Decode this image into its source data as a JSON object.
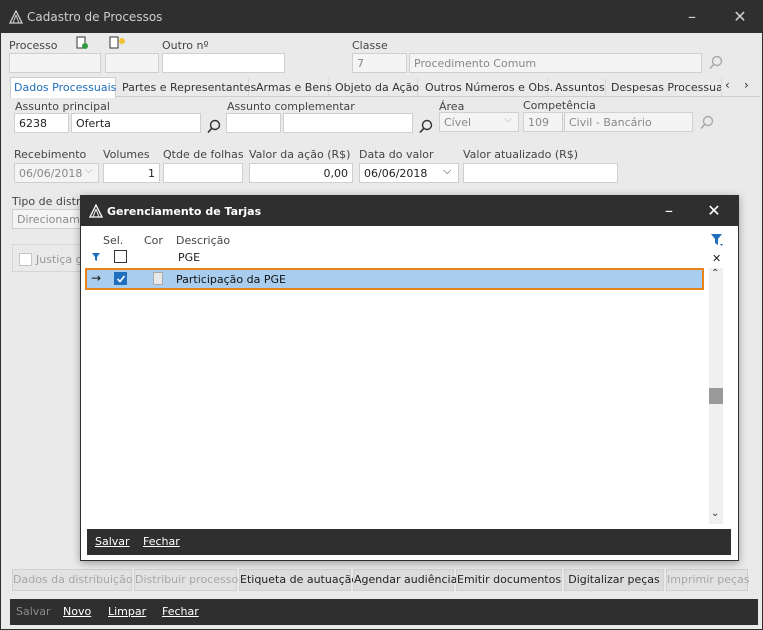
{
  "window": {
    "title": "Cadastro de Processos",
    "accent": "#1f6fbd",
    "dark": "#2f2f2f",
    "highlight_border": "#e8821a",
    "selected_row": "#a8cdee"
  },
  "header": {
    "processo_label": "Processo",
    "outro_label": "Outro nº",
    "classe_label": "Classe",
    "classe_code": "7",
    "classe_desc": "Procedimento Comum"
  },
  "tabs": [
    {
      "label": "Dados Processuais"
    },
    {
      "label": "Partes e Representantes"
    },
    {
      "label": "Armas e Bens"
    },
    {
      "label": "Objeto da Ação"
    },
    {
      "label": "Outros Números e Obs."
    },
    {
      "label": "Assuntos"
    },
    {
      "label": "Despesas Processuais"
    }
  ],
  "form": {
    "assunto_principal_label": "Assunto principal",
    "assunto_principal_code": "6238",
    "assunto_principal_desc": "Oferta",
    "assunto_complementar_label": "Assunto complementar",
    "area_label": "Área",
    "area_value": "Cível",
    "competencia_label": "Competência",
    "competencia_code": "109",
    "competencia_desc": "Civil - Bancário",
    "recebimento_label": "Recebimento",
    "recebimento_value": "06/06/2018",
    "volumes_label": "Volumes",
    "volumes_value": "1",
    "qtde_folhas_label": "Qtde de folhas",
    "valor_acao_label": "Valor da ação (R$)",
    "valor_acao_value": "0,00",
    "data_valor_label": "Data do valor",
    "data_valor_value": "06/06/2018",
    "valor_atualizado_label": "Valor atualizado (R$)",
    "tipo_distrib_label": "Tipo de distri",
    "tipo_distrib_value": "Direcioname",
    "justica_label": "Justiça g"
  },
  "modal": {
    "title": "Gerenciamento de Tarjas",
    "col_sel": "Sel.",
    "col_cor": "Cor",
    "col_desc": "Descrição",
    "filter_value": "PGE",
    "rows": [
      {
        "descricao": "Participação da PGE",
        "selected": true
      }
    ],
    "save_label": "Salvar",
    "close_label": "Fechar"
  },
  "actions": {
    "dados_distribuicao": "Dados da distribuição",
    "distribuir_processo": "Distribuir processo",
    "etiqueta_autuacao": "Etiqueta de autuação",
    "agendar_audiencia": "Agendar audiência",
    "emitir_documentos": "Emitir documentos",
    "digitalizar_pecas": "Digitalizar peças",
    "imprimir_pecas": "Imprimir peças"
  },
  "footer": {
    "salvar": "Salvar",
    "novo": "Novo",
    "limpar": "Limpar",
    "fechar": "Fechar"
  }
}
